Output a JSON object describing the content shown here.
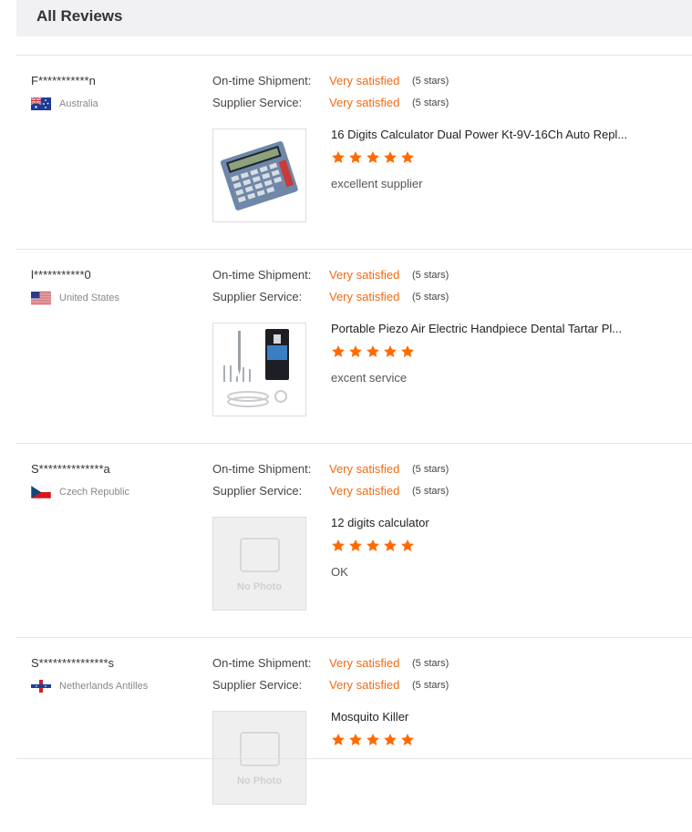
{
  "header": {
    "title": "All Reviews"
  },
  "labels": {
    "shipment": "On-time Shipment:",
    "service": "Supplier Service:",
    "no_photo": "No Photo"
  },
  "colors": {
    "accent": "#f26a10",
    "star": "#ff6a00"
  },
  "reviews": [
    {
      "user": "F***********n",
      "country": "Australia",
      "flag": "australia-flag-icon",
      "shipment_value": "Very satisfied",
      "shipment_stars": "(5 stars)",
      "service_value": "Very satisfied",
      "service_stars": "(5 stars)",
      "product": "16 Digits Calculator Dual Power Kt-9V-16Ch Auto Repl...",
      "rating": 5,
      "comment": "excellent supplier",
      "image": "calculator-photo"
    },
    {
      "user": "l***********0",
      "country": "United States",
      "flag": "usa-flag-icon",
      "shipment_value": "Very satisfied",
      "shipment_stars": "(5 stars)",
      "service_value": "Very satisfied",
      "service_stars": "(5 stars)",
      "product": "Portable Piezo Air Electric Handpiece Dental Tartar Pl...",
      "rating": 5,
      "comment": "excent service",
      "image": "dental-handpiece-photo"
    },
    {
      "user": "S**************a",
      "country": "Czech Republic",
      "flag": "czech-flag-icon",
      "shipment_value": "Very satisfied",
      "shipment_stars": "(5 stars)",
      "service_value": "Very satisfied",
      "service_stars": "(5 stars)",
      "product": "12 digits calculator",
      "rating": 5,
      "comment": "OK",
      "image": "no-photo"
    },
    {
      "user": "S***************s",
      "country": "Netherlands Antilles",
      "flag": "netherlands-antilles-flag-icon",
      "shipment_value": "Very satisfied",
      "shipment_stars": "(5 stars)",
      "service_value": "Very satisfied",
      "service_stars": "(5 stars)",
      "product": "Mosquito Killer",
      "rating": 5,
      "comment": "",
      "image": "no-photo"
    }
  ]
}
